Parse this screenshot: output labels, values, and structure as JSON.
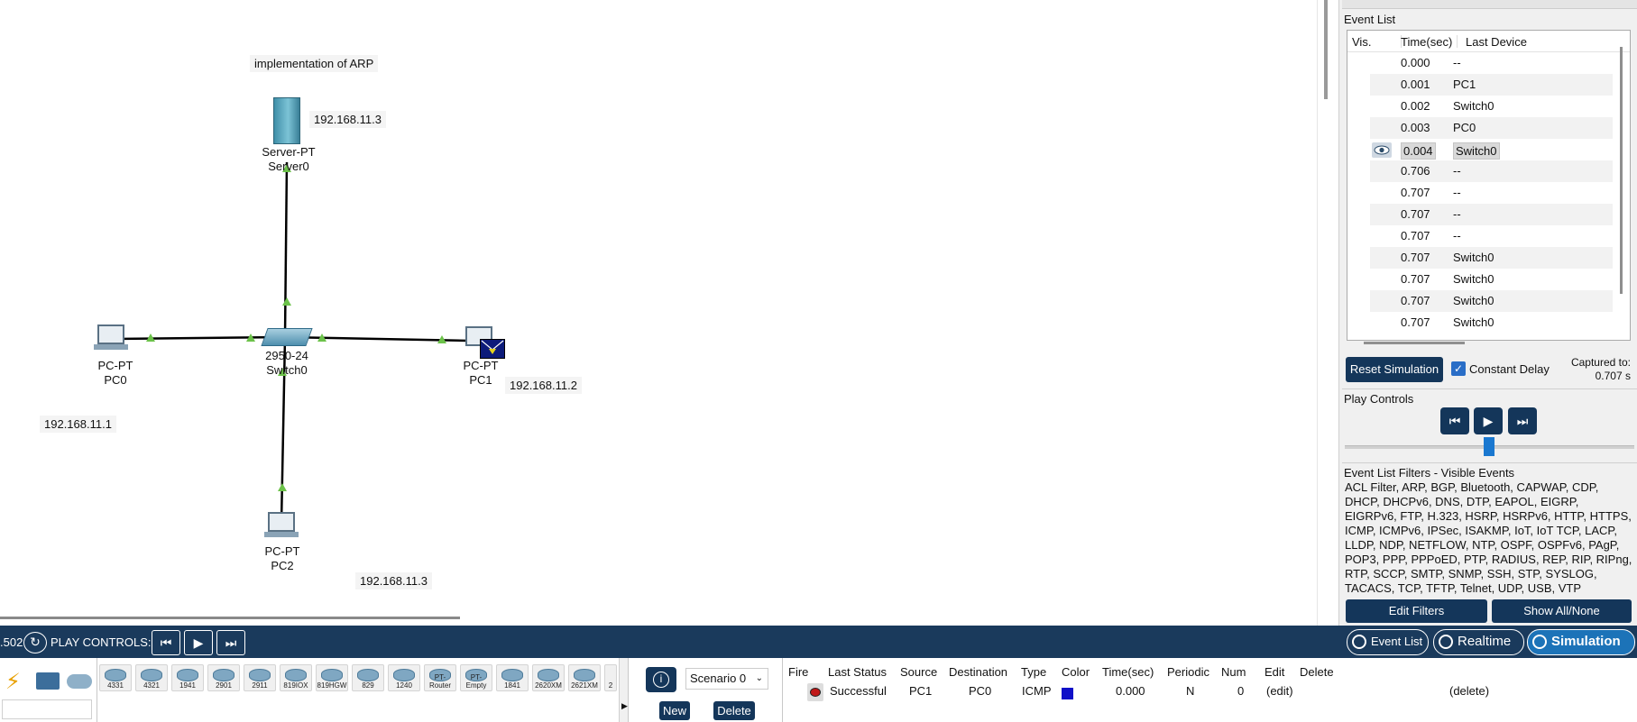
{
  "workspace": {
    "note_title": "implementation of ARP",
    "server": {
      "type": "Server-PT",
      "name": "Server0",
      "ip": "192.168.11.3"
    },
    "switch": {
      "type": "2950-24",
      "name": "Switch0"
    },
    "pc0": {
      "type": "PC-PT",
      "name": "PC0",
      "ip": "192.168.11.1"
    },
    "pc1": {
      "type": "PC-PT",
      "name": "PC1",
      "ip": "192.168.11.2"
    },
    "pc2": {
      "type": "PC-PT",
      "name": "PC2",
      "ip": "192.168.11.3"
    }
  },
  "event_list": {
    "title": "Event List",
    "columns": [
      "Vis.",
      "Time(sec)",
      "Last Device"
    ],
    "rows": [
      {
        "time": "0.000",
        "device": "--"
      },
      {
        "time": "0.001",
        "device": "PC1"
      },
      {
        "time": "0.002",
        "device": "Switch0"
      },
      {
        "time": "0.003",
        "device": "PC0"
      },
      {
        "time": "0.004",
        "device": "Switch0"
      },
      {
        "time": "0.706",
        "device": "--"
      },
      {
        "time": "0.707",
        "device": "--"
      },
      {
        "time": "0.707",
        "device": "--"
      },
      {
        "time": "0.707",
        "device": "--"
      },
      {
        "time": "0.707",
        "device": "Switch0"
      },
      {
        "time": "0.707",
        "device": "Switch0"
      },
      {
        "time": "0.707",
        "device": "Switch0"
      },
      {
        "time": "0.707",
        "device": "Switch0"
      }
    ],
    "selected_row": 4,
    "reset_label": "Reset Simulation",
    "constant_delay_label": "Constant Delay",
    "constant_delay_checked": true,
    "captured_label": "Captured to:",
    "captured_value": "0.707 s"
  },
  "play_controls": {
    "title": "Play Controls",
    "back_icon": "skip-back-icon",
    "play_icon": "play-icon",
    "forward_icon": "skip-forward-icon"
  },
  "filters": {
    "title": "Event List Filters - Visible Events",
    "text": "ACL Filter, ARP, BGP, Bluetooth, CAPWAP, CDP, DHCP, DHCPv6, DNS, DTP, EAPOL, EIGRP, EIGRPv6, FTP, H.323, HSRP, HSRPv6, HTTP, HTTPS, ICMP, ICMPv6, IPSec, ISAKMP, IoT, IoT TCP, LACP, LLDP, NDP, NETFLOW, NTP, OSPF, OSPFv6, PAgP, POP3, PPP, PPPoED, PTP, RADIUS, REP, RIP, RIPng, RTP, SCCP, SMTP, SNMP, SSH, STP, SYSLOG, TACACS, TCP, TFTP, Telnet, UDP, USB, VTP",
    "edit_label": "Edit Filters",
    "show_label": "Show All/None"
  },
  "bottom_bar": {
    "time_value": ".502",
    "play_controls_label": "PLAY CONTROLS:",
    "event_list_tab": "Event List",
    "realtime_tab": "Realtime",
    "simulation_tab": "Simulation"
  },
  "device_models": [
    "4331",
    "4321",
    "1941",
    "2901",
    "2911",
    "819IOX",
    "819HGW",
    "829",
    "1240",
    "PT-Router",
    "PT-Empty",
    "1841",
    "2620XM",
    "2621XM",
    "2"
  ],
  "scenario": {
    "selected": "Scenario 0",
    "new_label": "New",
    "delete_label": "Delete"
  },
  "pdu_table": {
    "columns": [
      "Fire",
      "Last Status",
      "Source",
      "Destination",
      "Type",
      "Color",
      "Time(sec)",
      "Periodic",
      "Num",
      "Edit",
      "Delete"
    ],
    "row": {
      "status": "Successful",
      "source": "PC1",
      "destination": "PC0",
      "type": "ICMP",
      "color": "#1010c8",
      "time": "0.000",
      "periodic": "N",
      "num": "0",
      "edit": "(edit)",
      "delete": "(delete)"
    }
  },
  "colors": {
    "accent": "#14365a",
    "bar": "#1a3a5c",
    "active_tab": "#1c73b8",
    "link_arrow": "#6cc24a"
  }
}
